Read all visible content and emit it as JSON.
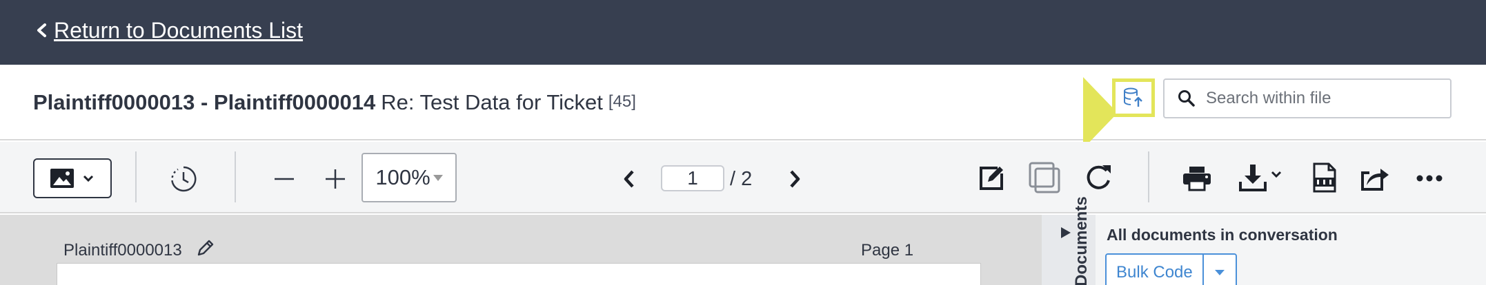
{
  "topbar": {
    "back_label": "Return to Documents List",
    "back_icon": "chevron-left-icon",
    "background": "#373f50"
  },
  "document": {
    "bates_range": "Plaintiff0000013 - Plaintiff0000014",
    "subject": "Re: Test Data for Ticket",
    "count": "[45]"
  },
  "header_actions": {
    "upload_icon": "database-upload-icon",
    "highlight_color": "#e3e55a",
    "search": {
      "placeholder": "Search within file",
      "value": ""
    }
  },
  "toolbar": {
    "image_view_icon": "image-icon",
    "history_icon": "history-icon",
    "zoom_out_icon": "minus-icon",
    "zoom_in_icon": "plus-icon",
    "zoom_level": "100%",
    "prev_page_icon": "chevron-left-icon",
    "current_page": "1",
    "page_total": "/ 2",
    "next_page_icon": "chevron-right-icon",
    "annotate_icon": "edit-icon",
    "overlay_icon": "layers-icon",
    "rotate_icon": "rotate-icon",
    "print_icon": "printer-icon",
    "download_icon": "download-icon",
    "pdf_icon": "pdf-icon",
    "share_icon": "share-icon",
    "more_icon": "more-icon"
  },
  "viewer": {
    "page_label": "Plaintiff0000013",
    "page_number": "Page 1"
  },
  "side_panel": {
    "tab_label": "Documents",
    "title": "All documents in conversation",
    "bulk_code_label": "Bulk Code",
    "accent": "#4a90d9"
  }
}
